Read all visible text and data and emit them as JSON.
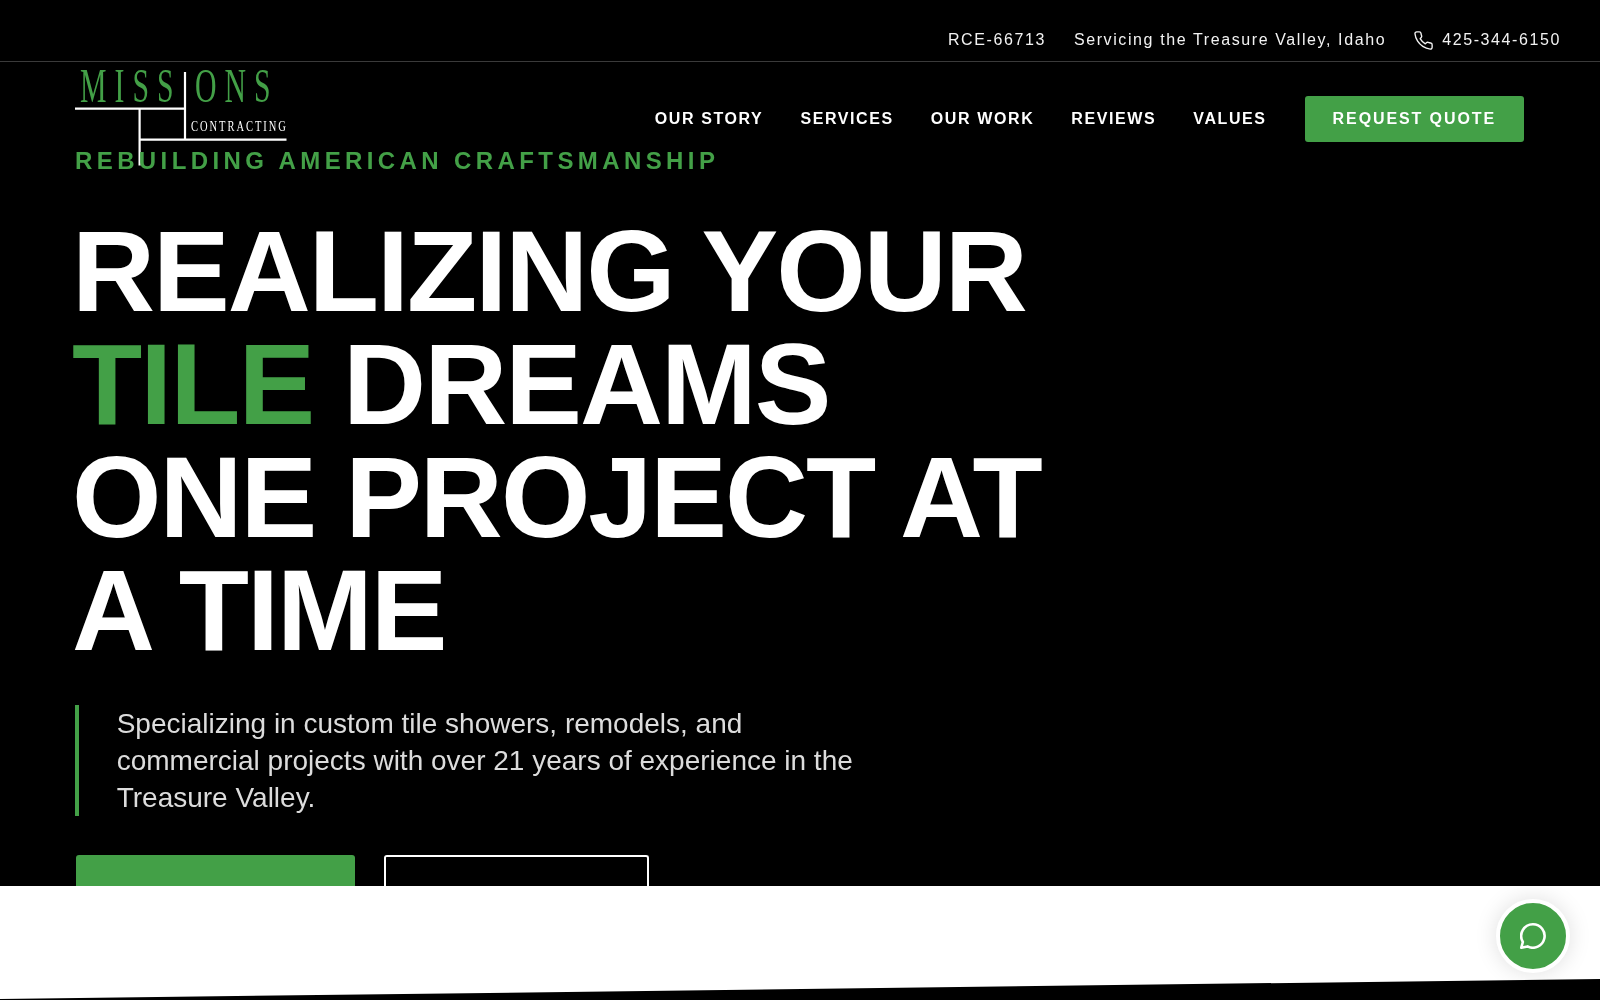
{
  "top_bar": {
    "license": "RCE-66713",
    "service_area": "Servicing the Treasure Valley, Idaho",
    "phone": "425-344-6150"
  },
  "logo": {
    "wordmark": [
      "MISS",
      "ONS"
    ],
    "subtitle": "CONTRACTING"
  },
  "tagline": "REBUILDING AMERICAN CRAFTSMANSHIP",
  "nav": {
    "links": [
      "OUR STORY",
      "SERVICES",
      "OUR WORK",
      "REVIEWS",
      "VALUES"
    ],
    "cta": "REQUEST QUOTE"
  },
  "hero": {
    "headline": [
      [
        {
          "text": "REALIZING YOUR",
          "accent": false
        }
      ],
      [
        {
          "text": "TILE",
          "accent": true
        },
        {
          "text": "DREAMS",
          "accent": false
        }
      ],
      [
        {
          "text": "ONE PROJECT AT",
          "accent": false
        }
      ],
      [
        {
          "text": "A TIME",
          "accent": false
        }
      ]
    ],
    "description": "Specializing in custom tile showers, remodels, and commercial projects with over 21 years of experience in the Treasure Valley.",
    "buttons": [
      {
        "kind": "filled"
      },
      {
        "kind": "outline"
      }
    ]
  }
}
